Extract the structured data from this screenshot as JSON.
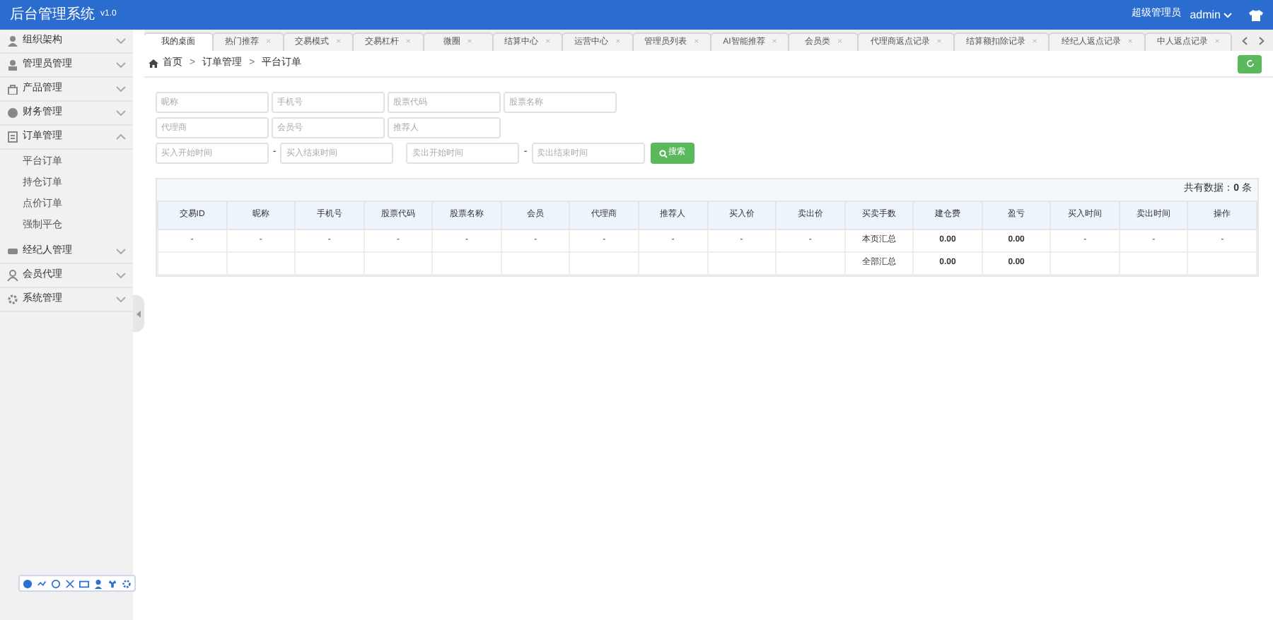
{
  "header": {
    "title": "后台管理系统",
    "version": "v1.0",
    "role": "超级管理员",
    "user": "admin"
  },
  "sidebar": {
    "items": [
      {
        "label": "组织架构",
        "expanded": false
      },
      {
        "label": "管理员管理",
        "expanded": false
      },
      {
        "label": "产品管理",
        "expanded": false
      },
      {
        "label": "财务管理",
        "expanded": false
      },
      {
        "label": "订单管理",
        "expanded": true,
        "children": [
          {
            "label": "平台订单"
          },
          {
            "label": "持仓订单"
          },
          {
            "label": "点价订单"
          },
          {
            "label": "强制平仓"
          }
        ]
      },
      {
        "label": "经纪人管理",
        "expanded": false
      },
      {
        "label": "会员代理",
        "expanded": false
      },
      {
        "label": "系统管理",
        "expanded": false
      }
    ]
  },
  "tabs": [
    {
      "label": "我的桌面",
      "selected": true
    },
    {
      "label": "热门推荐",
      "close": "×",
      "selected": false
    },
    {
      "label": "交易模式",
      "close": "×",
      "selected": false
    },
    {
      "label": "交易杠杆",
      "close": "×",
      "selected": false
    },
    {
      "label": "微圈",
      "close": "×",
      "selected": false
    },
    {
      "label": "结算中心",
      "close": "×",
      "selected": false
    },
    {
      "label": "运营中心",
      "close": "×",
      "selected": false
    },
    {
      "label": "管理员列表",
      "close": "×",
      "selected": false
    },
    {
      "label": "AI智能推荐",
      "close": "×",
      "selected": false
    },
    {
      "label": "会员类",
      "close": "×",
      "selected": false
    },
    {
      "label": "代理商返点记录",
      "close": "×",
      "selected": false
    },
    {
      "label": "结算额扣除记录",
      "close": "×",
      "selected": false
    },
    {
      "label": "经纪人返点记录",
      "close": "×",
      "selected": false
    },
    {
      "label": "中人返点记录",
      "close": "×",
      "selected": false
    }
  ],
  "breadcrumb": [
    "首页",
    "订单管理",
    "平台订单"
  ],
  "breadcrumb_separator": ">",
  "filters": {
    "row_1": [
      {
        "placeholder": "昵称"
      },
      {
        "placeholder": "手机号"
      },
      {
        "placeholder": "股票代码"
      },
      {
        "placeholder": "股票名称"
      }
    ],
    "row_2": [
      {
        "placeholder": "代理商"
      },
      {
        "placeholder": "会员号"
      },
      {
        "placeholder": "推荐人"
      }
    ],
    "date_ranges": [
      {
        "from": {
          "placeholder": "买入开始时间"
        },
        "to": {
          "placeholder": "买入结束时间"
        }
      },
      {
        "from": {
          "placeholder": "卖出开始时间"
        },
        "to": {
          "placeholder": "卖出结束时间"
        }
      }
    ],
    "range_separator": "-",
    "search_button": "搜索"
  },
  "table": {
    "count": "共有数据：**0** 条",
    "columns": [
      "交易ID",
      "昵称",
      "手机号",
      "股票代码",
      "股票名称",
      "会员",
      "代理商",
      "推荐人",
      "买入价",
      "卖出价",
      "买卖手数",
      "建仓费",
      "盈亏",
      "买入时间",
      "卖出时间",
      "操作"
    ],
    "rows": [
      [
        "-",
        "-",
        "-",
        "-",
        "-",
        "-",
        "-",
        "-",
        "-",
        "-",
        "本页汇总",
        "0.00",
        "0.00",
        "-",
        "-",
        "-"
      ],
      [
        null,
        null,
        null,
        null,
        null,
        null,
        null,
        null,
        null,
        null,
        "全部汇总",
        "0.00",
        "0.00",
        null,
        null,
        null
      ]
    ]
  }
}
